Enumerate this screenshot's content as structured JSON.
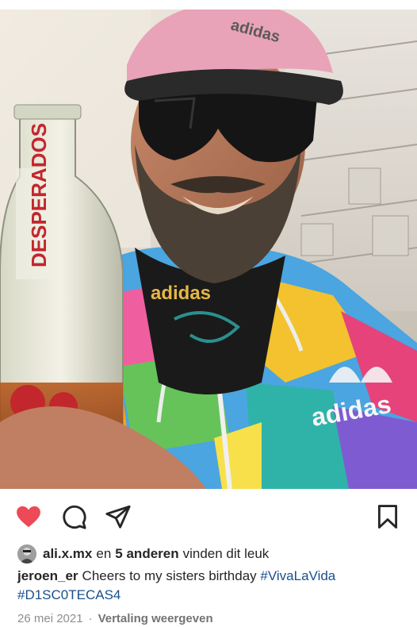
{
  "post": {
    "photo_alt": "Selfie with beer bottle",
    "photo_text": {
      "bottle_brand": "DESPERADOS",
      "cap_brand": "adidas",
      "collar_brand": "adidas",
      "jacket_brand": "adidas"
    },
    "actions": {
      "like_icon": "heart-filled-icon",
      "comment_icon": "comment-icon",
      "share_icon": "paper-plane-icon",
      "save_icon": "bookmark-icon",
      "like_color": "#ed4956"
    },
    "likes": {
      "first_user": "ali.x.mx",
      "connector": "en",
      "others": "5 anderen",
      "suffix": "vinden dit leuk"
    },
    "caption": {
      "username": "jeroen_er",
      "text": "Cheers to my sisters birthday",
      "hashtags": [
        "#VivaLaVida",
        "#D1SC0TECAS4"
      ]
    },
    "meta": {
      "date": "26 mei 2021",
      "separator": "·",
      "translate": "Vertaling weergeven"
    }
  }
}
